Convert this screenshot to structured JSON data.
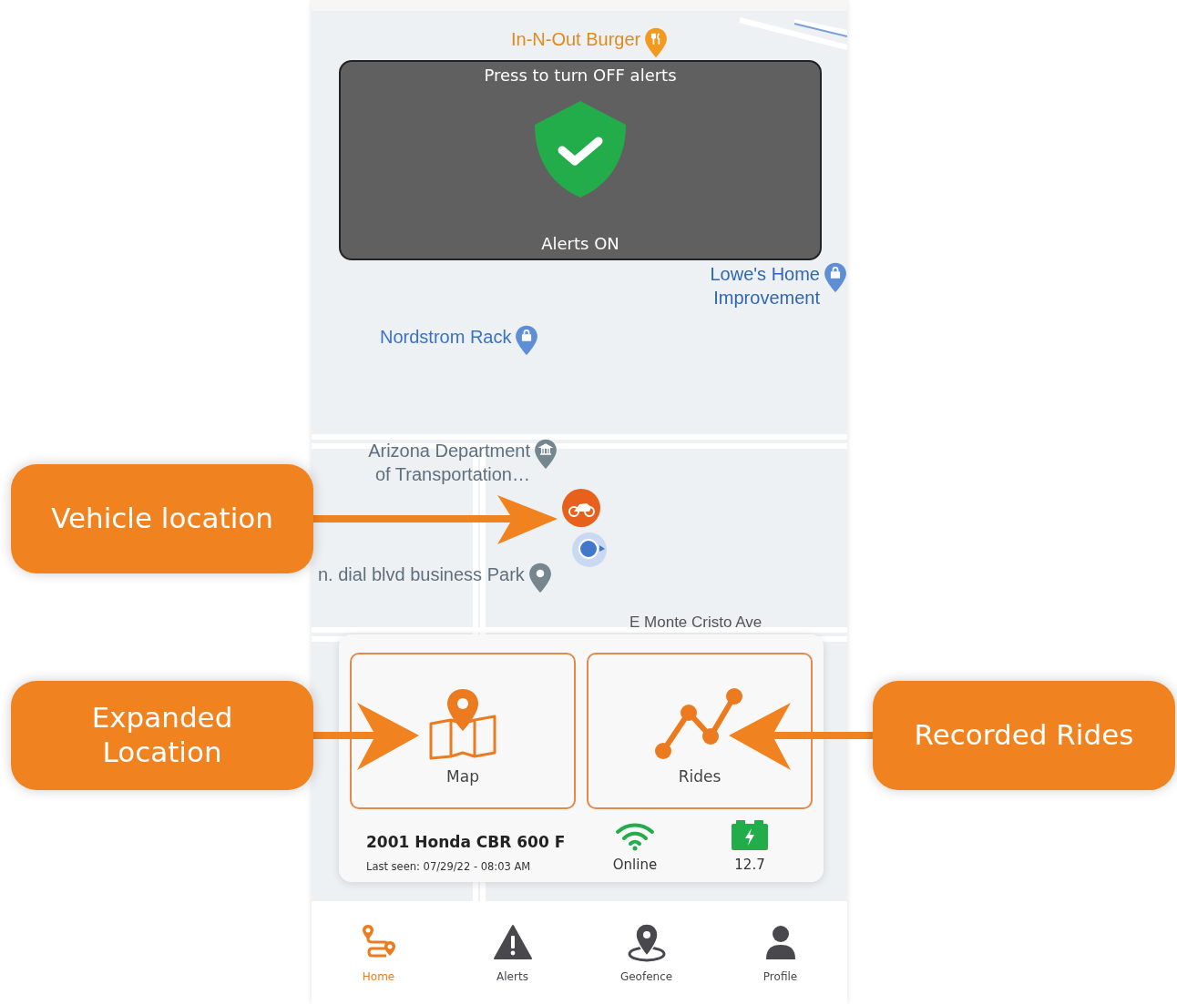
{
  "map": {
    "places": [
      {
        "kind": "food",
        "name": "In-N-Out Burger"
      },
      {
        "kind": "store",
        "name": "Lowe's Home Improvement"
      },
      {
        "kind": "shopping",
        "name": "Nordstrom Rack"
      },
      {
        "kind": "government",
        "name": "Arizona Department of Transportation…"
      },
      {
        "kind": "generic",
        "name": "n. dial blvd business Park"
      }
    ],
    "street": "E Monte Cristo Ave"
  },
  "alerts_panel": {
    "hint": "Press to turn OFF alerts",
    "status": "Alerts ON",
    "on": true
  },
  "vehicle_card": {
    "actions": [
      {
        "kind": "map",
        "label": "Map"
      },
      {
        "kind": "rides",
        "label": "Rides"
      }
    ],
    "vehicle": "2001 Honda CBR 600 F",
    "last_seen": "Last seen: 07/29/22 - 08:03 AM",
    "connection": "Online",
    "online": true,
    "battery": "12.7"
  },
  "nav": [
    {
      "kind": "home",
      "label": "Home",
      "selected": true
    },
    {
      "kind": "alerts",
      "label": "Alerts",
      "selected": false
    },
    {
      "kind": "geofence",
      "label": "Geofence",
      "selected": false
    },
    {
      "kind": "profile",
      "label": "Profile",
      "selected": false
    }
  ],
  "callouts": [
    {
      "text": "Vehicle location"
    },
    {
      "text": "Expanded Location"
    },
    {
      "text": "Recorded Rides"
    }
  ]
}
